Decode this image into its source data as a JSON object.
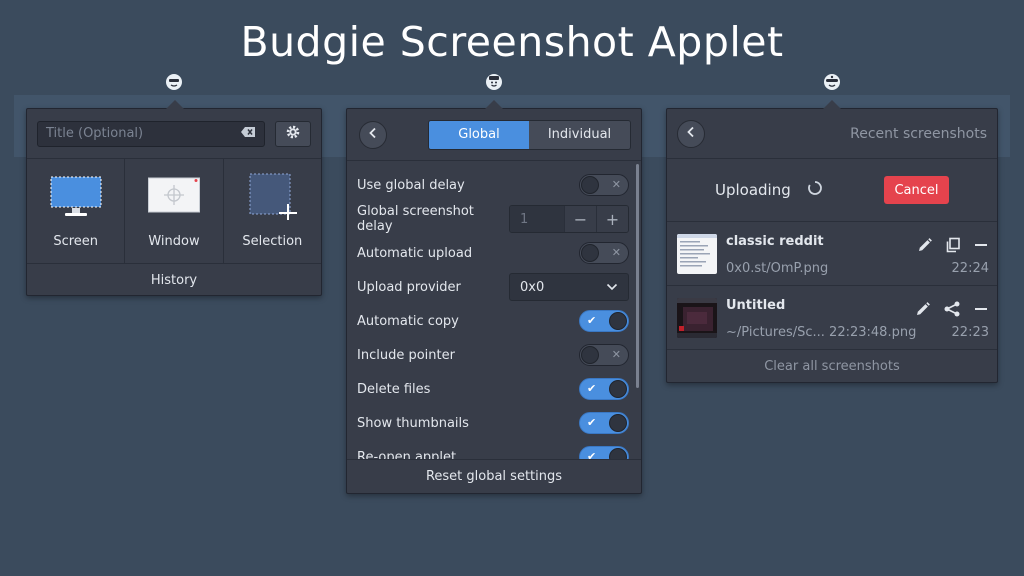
{
  "page_title": "Budgie Screenshot Applet",
  "capture_popover": {
    "title_placeholder": "Title (Optional)",
    "modes": [
      {
        "label": "Screen"
      },
      {
        "label": "Window"
      },
      {
        "label": "Selection"
      }
    ],
    "history_label": "History"
  },
  "settings_popover": {
    "tabs": {
      "global": "Global",
      "individual": "Individual"
    },
    "rows": [
      {
        "label": "Use global delay",
        "type": "switch",
        "on": false
      },
      {
        "label": "Global screenshot delay",
        "type": "spin",
        "value": "1"
      },
      {
        "label": "Automatic upload",
        "type": "switch",
        "on": false
      },
      {
        "label": "Upload provider",
        "type": "combo",
        "value": "0x0"
      },
      {
        "label": "Automatic copy",
        "type": "switch",
        "on": true
      },
      {
        "label": "Include pointer",
        "type": "switch",
        "on": false
      },
      {
        "label": "Delete files",
        "type": "switch",
        "on": true
      },
      {
        "label": "Show thumbnails",
        "type": "switch",
        "on": true
      },
      {
        "label": "Re-open applet",
        "type": "switch",
        "on": true
      }
    ],
    "reset_label": "Reset global settings"
  },
  "recent_popover": {
    "header": "Recent screenshots",
    "uploading_label": "Uploading",
    "cancel_label": "Cancel",
    "shots": [
      {
        "name": "classic reddit",
        "path": "0x0.st/OmP.png",
        "time": "22:24"
      },
      {
        "name": "Untitled",
        "path": "~/Pictures/Sc... 22:23:48.png",
        "time": "22:23"
      }
    ],
    "clear_label": "Clear all screenshots"
  },
  "colors": {
    "accent": "#4a8fdf",
    "danger": "#e5434d",
    "background": "#3b4b5d",
    "popover": "#383d49"
  }
}
